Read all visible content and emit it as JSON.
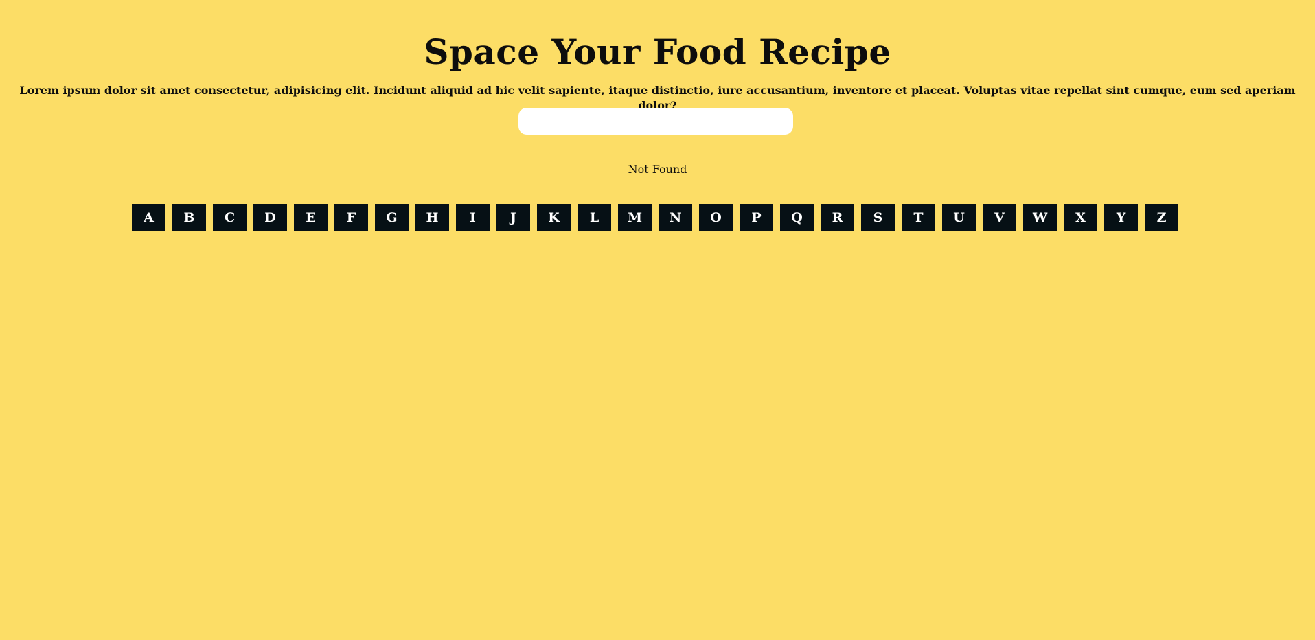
{
  "header": {
    "title": "Space Your Food Recipe",
    "description": "Lorem ipsum dolor sit amet consectetur, adipisicing elit. Incidunt aliquid ad hic velit sapiente, itaque distinctio, iure accusantium, inventore et placeat. Voluptas vitae repellat sint cumque, eum sed aperiam dolor?"
  },
  "search": {
    "value": "",
    "placeholder": ""
  },
  "results": {
    "status": "Not Found"
  },
  "alphabet": {
    "letters": [
      "A",
      "B",
      "C",
      "D",
      "E",
      "F",
      "G",
      "H",
      "I",
      "J",
      "K",
      "L",
      "M",
      "N",
      "O",
      "P",
      "Q",
      "R",
      "S",
      "T",
      "U",
      "V",
      "W",
      "X",
      "Y",
      "Z"
    ]
  },
  "colors": {
    "background": "#fcdd66",
    "button_background": "#061015",
    "button_text": "#ffffff",
    "input_background": "#ffffff",
    "text": "#0d0d0d"
  }
}
